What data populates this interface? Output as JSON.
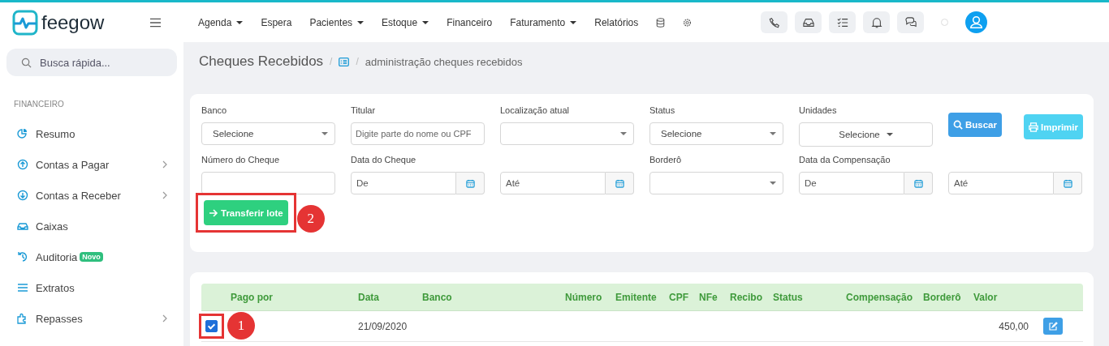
{
  "top_bar": {
    "logo": "feegow",
    "nav": [
      {
        "label": "Agenda",
        "dropdown": true
      },
      {
        "label": "Espera",
        "dropdown": false
      },
      {
        "label": "Pacientes",
        "dropdown": true
      },
      {
        "label": "Estoque",
        "dropdown": true
      },
      {
        "label": "Financeiro",
        "dropdown": false
      },
      {
        "label": "Faturamento",
        "dropdown": true
      },
      {
        "label": "Relatórios",
        "dropdown": false
      }
    ]
  },
  "sidebar": {
    "search": {
      "placeholder": "Busca rápida..."
    },
    "section": "FINANCEIRO",
    "items": [
      {
        "label": "Resumo",
        "kind": "chart",
        "expandable": false
      },
      {
        "label": "Contas a Pagar",
        "kind": "up",
        "expandable": true
      },
      {
        "label": "Contas a Receber",
        "kind": "down",
        "expandable": true
      },
      {
        "label": "Caixas",
        "kind": "inbox",
        "expandable": false
      },
      {
        "label": "Auditoria",
        "kind": "history",
        "expandable": false,
        "badge": "Novo"
      },
      {
        "label": "Extratos",
        "kind": "list",
        "expandable": false
      },
      {
        "label": "Repasses",
        "kind": "puzzle",
        "expandable": true
      }
    ]
  },
  "breadcrumb": {
    "title": "Cheques Recebidos",
    "separators": [
      "/",
      "/"
    ],
    "current": "administração cheques recebidos"
  },
  "filters": {
    "rows": [
      [
        {
          "kind": "select",
          "label": "Banco",
          "value": "Selecione"
        },
        {
          "kind": "text",
          "label": "Titular",
          "placeholder": "Digite parte do nome ou CPF"
        },
        {
          "kind": "select",
          "label": "Localização atual"
        },
        {
          "kind": "select",
          "label": "Status",
          "value": "Selecione"
        },
        {
          "kind": "multiselect",
          "label": "Unidades",
          "value": "Selecione"
        },
        {
          "kind": "actions",
          "buttons": [
            {
              "label": "Buscar",
              "kind": "search"
            },
            {
              "label": "Imprimir",
              "kind": "print"
            }
          ]
        }
      ],
      [
        {
          "kind": "text",
          "label": "Número do Cheque"
        },
        {
          "kind": "date",
          "label": "Data do Cheque",
          "placeholder": "De"
        },
        {
          "kind": "date",
          "placeholder": "Até"
        },
        {
          "kind": "select",
          "label": "Borderô"
        },
        {
          "kind": "date",
          "label": "Data da Compensação",
          "placeholder": "De"
        },
        {
          "kind": "date",
          "placeholder": "Até"
        }
      ]
    ],
    "transfer_button": {
      "label": "Transferir lote",
      "annotation": "2"
    }
  },
  "table": {
    "columns": [
      "Pago por",
      "Data",
      "Banco",
      "Número",
      "Emitente",
      "CPF",
      "NFe",
      "Recibo",
      "Status",
      "Compensação",
      "Borderô",
      "Valor"
    ],
    "rows": [
      {
        "selected": true,
        "annotation": "1",
        "cells": [
          "",
          "21/09/2020",
          "",
          "",
          "",
          "",
          "",
          "",
          "",
          "",
          "",
          "450,00"
        ]
      }
    ]
  }
}
